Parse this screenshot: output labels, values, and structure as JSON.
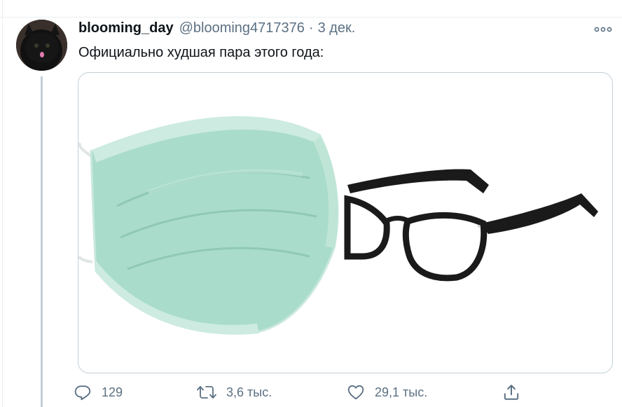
{
  "tweet": {
    "display_name": "blooming_day",
    "handle": "@blooming4717376",
    "separator": "·",
    "date": "3 дек.",
    "text": "Официально худшая пара этого года:",
    "media": {
      "items": [
        "medical-mask",
        "eyeglasses"
      ],
      "mask_color": "#a9dccb",
      "frame_color": "#1a1a1a"
    }
  },
  "actions": {
    "reply": {
      "icon": "reply-icon",
      "count": "129"
    },
    "retweet": {
      "icon": "retweet-icon",
      "count": "3,6 тыс."
    },
    "like": {
      "icon": "heart-icon",
      "count": "29,1 тыс."
    },
    "share": {
      "icon": "share-icon"
    }
  },
  "colors": {
    "text_primary": "#0f1419",
    "text_secondary": "#5b7083",
    "border": "#c4cfd6"
  }
}
